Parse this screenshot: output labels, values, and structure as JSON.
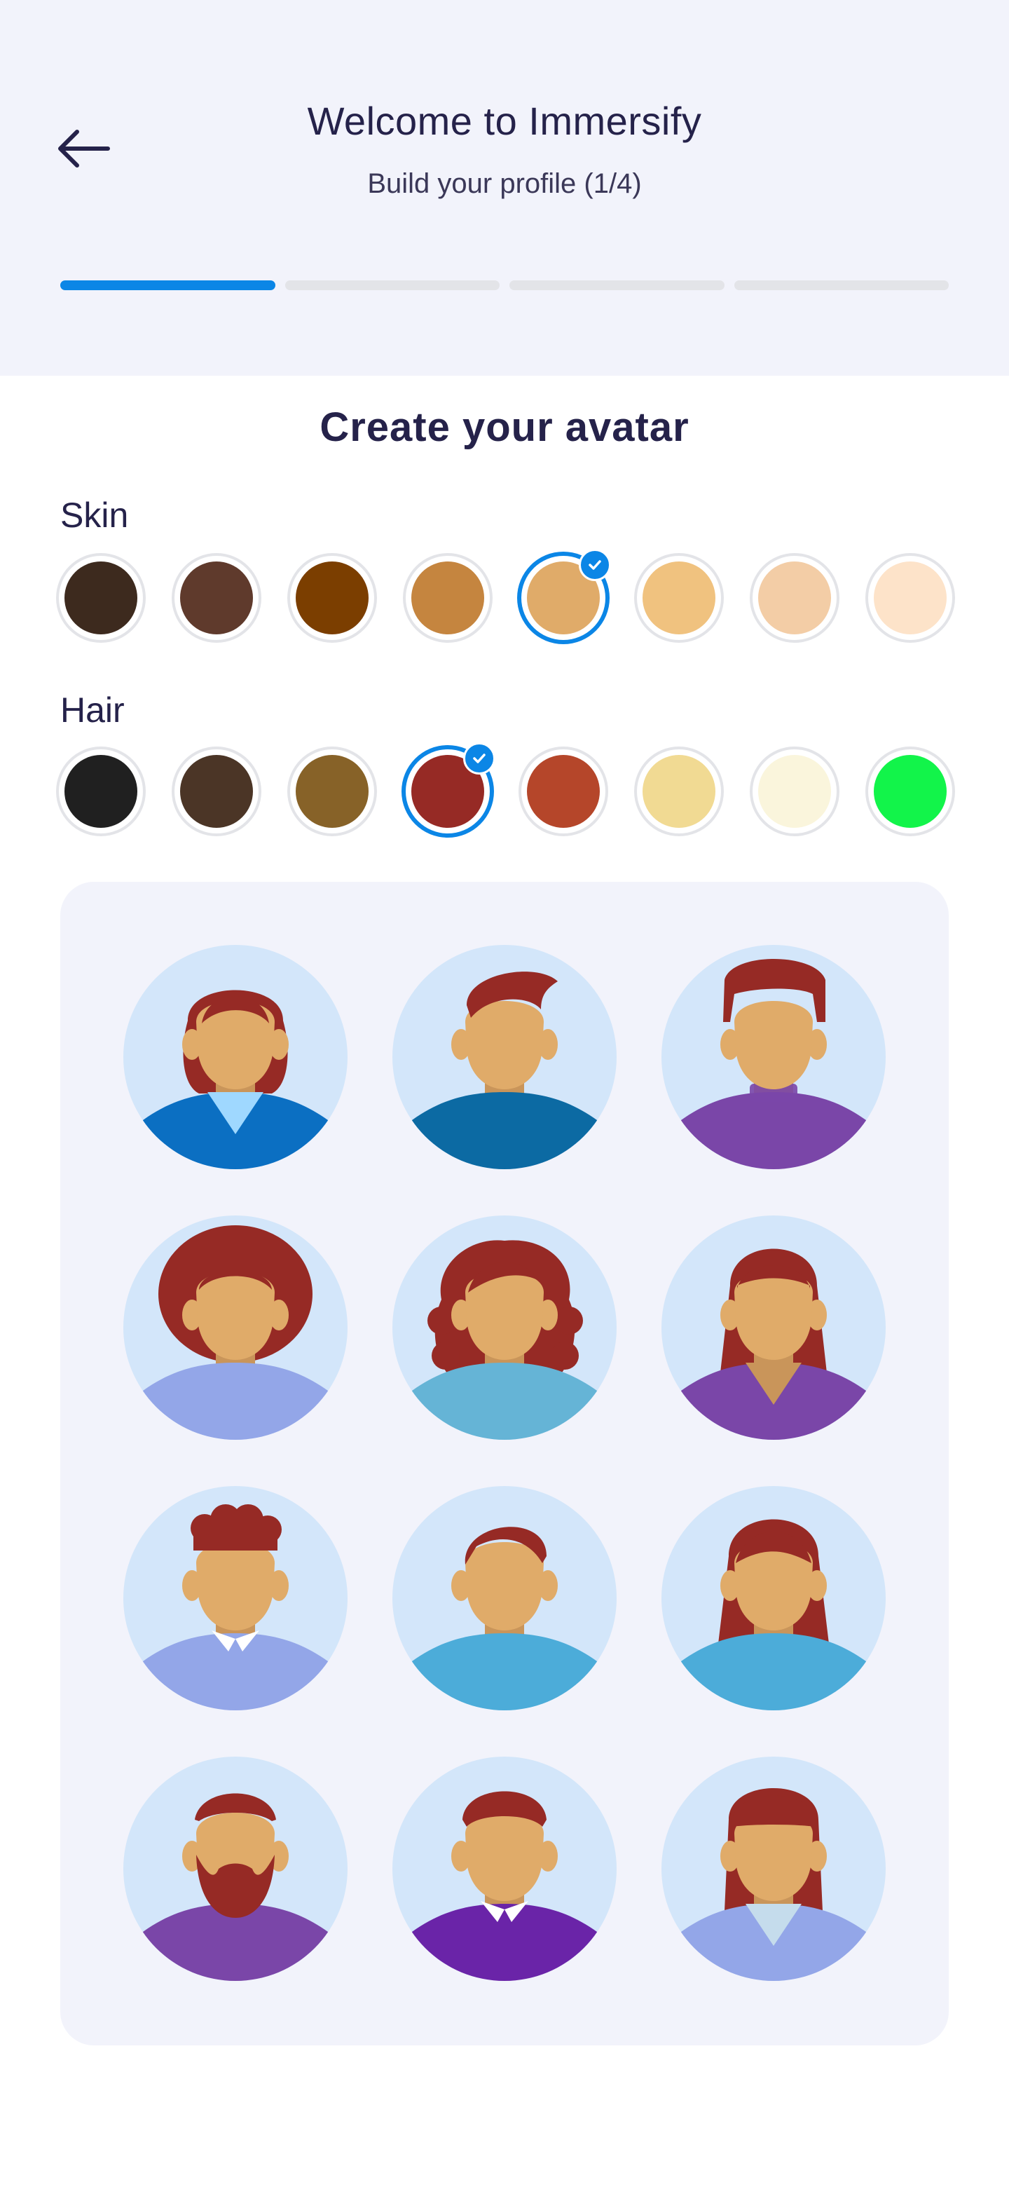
{
  "header": {
    "title": "Welcome to Immersify",
    "subtitle": "Build your profile (1/4)",
    "back_icon": "arrow-left-icon",
    "progress": {
      "total_steps": 4,
      "current_step": 1
    }
  },
  "section_title": "Create your avatar",
  "skin": {
    "label": "Skin",
    "selected_index": 4,
    "colors": [
      "#3d2a1e",
      "#5f3a2c",
      "#7b3e00",
      "#c5853f",
      "#e0ab69",
      "#f0c27f",
      "#f3cda6",
      "#fde3c9"
    ]
  },
  "hair": {
    "label": "Hair",
    "selected_index": 3,
    "colors": [
      "#202020",
      "#4b3526",
      "#876228",
      "#962a25",
      "#b5462a",
      "#f1da93",
      "#faf5dc",
      "#12f44a"
    ]
  },
  "avatar_colors": {
    "skin": "#e0ab69",
    "neck": "#c9955a",
    "hair": "#962a25",
    "background": "#d3e6fa"
  },
  "avatars": [
    {
      "name": "avatar-bob-blue",
      "style": "bob",
      "shirt": "#0b6fc2",
      "inner": "#9fd8ff",
      "collar": "vneck"
    },
    {
      "name": "avatar-swept-teal",
      "style": "swept",
      "shirt": "#0c6aa3",
      "inner": "",
      "collar": "crew"
    },
    {
      "name": "avatar-quiff-purple",
      "style": "quiff",
      "shirt": "#7a46a8",
      "inner": "",
      "collar": "turtle"
    },
    {
      "name": "avatar-afro-lavender",
      "style": "afro",
      "shirt": "#93a6e8",
      "inner": "",
      "collar": "crew"
    },
    {
      "name": "avatar-curly-skyblue",
      "style": "curly",
      "shirt": "#65b4d6",
      "inner": "",
      "collar": "crew"
    },
    {
      "name": "avatar-long-purple",
      "style": "long",
      "shirt": "#7a46a8",
      "inner": "",
      "collar": "vneck"
    },
    {
      "name": "avatar-curlytop-collar",
      "style": "curlytop",
      "shirt": "#93a6e8",
      "inner": "",
      "collar": "shirt"
    },
    {
      "name": "avatar-sidepart-blue",
      "style": "sidepart",
      "shirt": "#4cacd9",
      "inner": "",
      "collar": "crew"
    },
    {
      "name": "avatar-longwave-blue",
      "style": "longwave",
      "shirt": "#4cacd9",
      "inner": "",
      "collar": "crew"
    },
    {
      "name": "avatar-beard-purple",
      "style": "beard",
      "shirt": "#7a46a8",
      "inner": "",
      "collar": "turtle"
    },
    {
      "name": "avatar-short-collar",
      "style": "short",
      "shirt": "#6a24a8",
      "inner": "",
      "collar": "shirt"
    },
    {
      "name": "avatar-bangs-lavender",
      "style": "bangs",
      "shirt": "#93a6e8",
      "inner": "#c5dcec",
      "collar": "vneck"
    }
  ]
}
